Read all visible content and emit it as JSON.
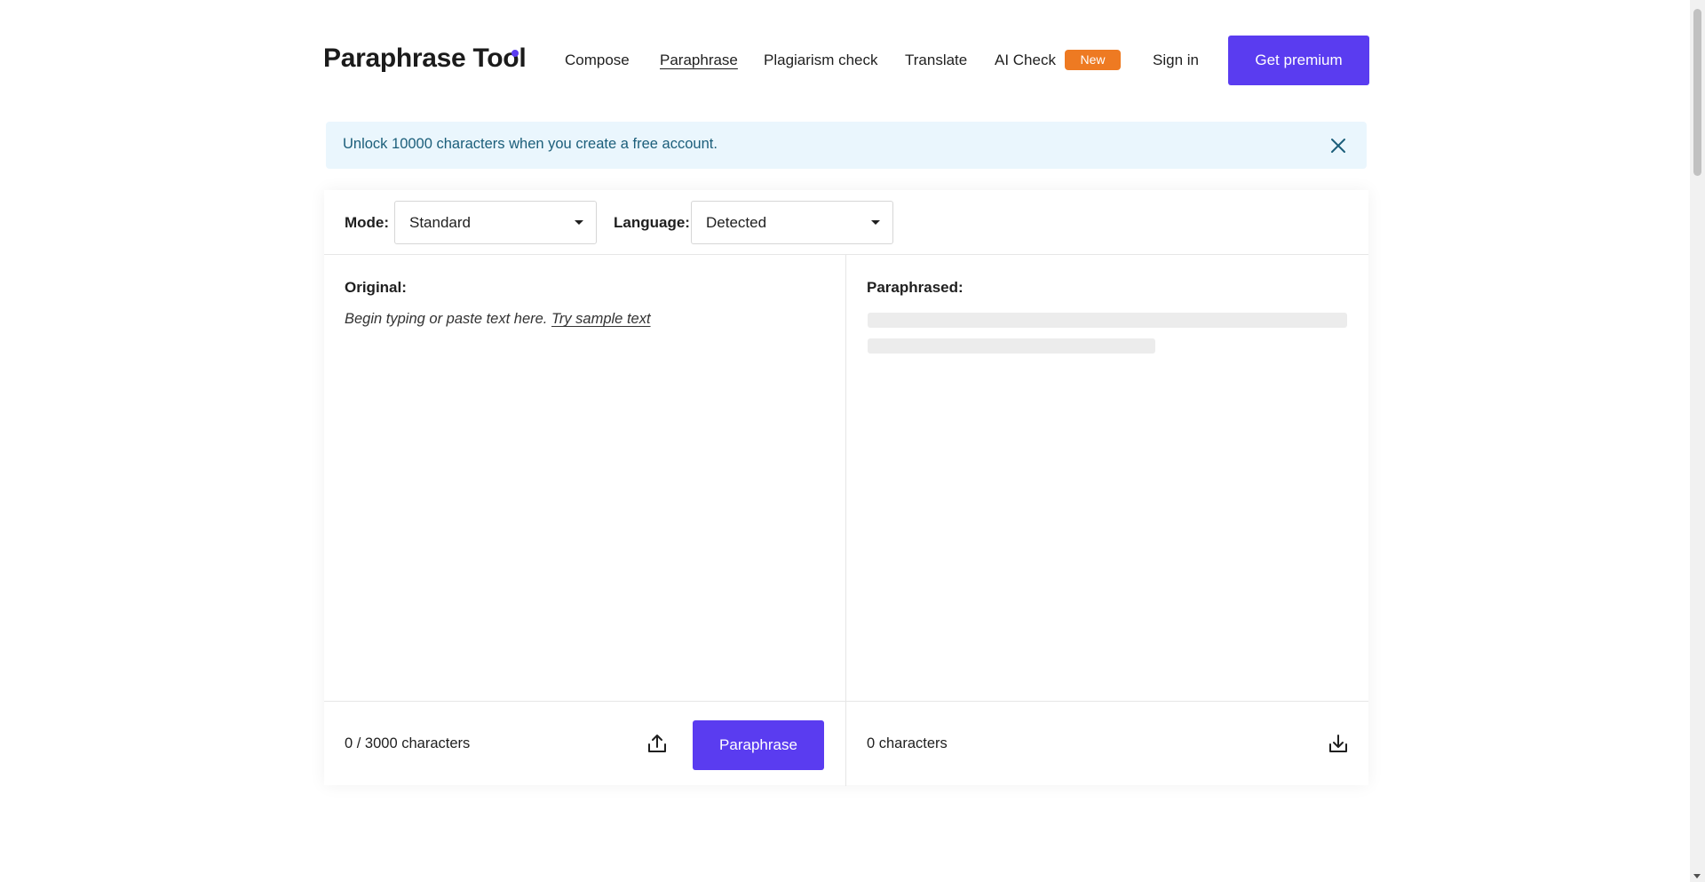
{
  "header": {
    "logo": "Paraphrase Tool",
    "nav": {
      "compose": "Compose",
      "paraphrase": "Paraphrase",
      "plagiarism": "Plagiarism check",
      "translate": "Translate",
      "ai_check": "AI Check"
    },
    "new_badge": "New",
    "sign_in": "Sign in",
    "premium": "Get premium"
  },
  "banner": {
    "text": "Unlock 10000 characters when you create a free account.",
    "close_icon": "close-icon"
  },
  "toolbar": {
    "mode_label": "Mode:",
    "mode_value": "Standard",
    "language_label": "Language:",
    "language_value": "Detected"
  },
  "original": {
    "label": "Original:",
    "placeholder": "Begin typing or paste text here.",
    "sample_link": "Try sample text",
    "count": "0 / 3000 characters",
    "upload_icon": "upload-icon",
    "paraphrase_button": "Paraphrase"
  },
  "paraphrased": {
    "label": "Paraphrased:",
    "count": "0 characters",
    "download_icon": "download-icon"
  },
  "colors": {
    "accent": "#5a3cf0",
    "badge": "#ee7a22",
    "banner_bg": "#eaf6fd",
    "banner_text": "#1b5e7a"
  }
}
